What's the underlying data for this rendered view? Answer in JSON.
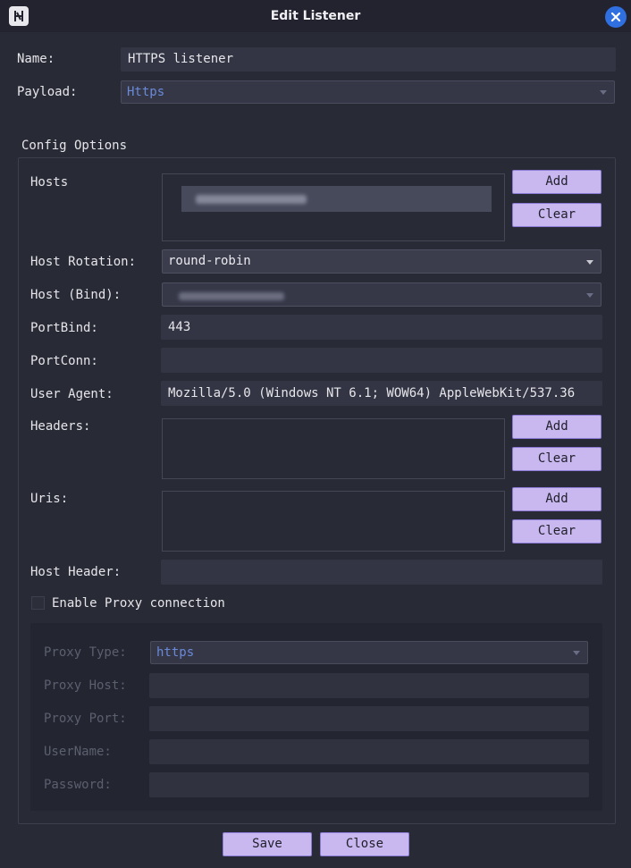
{
  "window": {
    "title": "Edit Listener"
  },
  "name": {
    "label": "Name:",
    "value": "HTTPS listener"
  },
  "payload": {
    "label": "Payload:",
    "value": "Https"
  },
  "config": {
    "group_title": "Config Options",
    "hosts": {
      "label": "Hosts",
      "add_label": "Add",
      "clear_label": "Clear"
    },
    "host_rotation": {
      "label": "Host Rotation:",
      "value": "round-robin"
    },
    "host_bind": {
      "label": "Host (Bind):"
    },
    "port_bind": {
      "label": "PortBind:",
      "value": "443"
    },
    "port_conn": {
      "label": "PortConn:",
      "value": ""
    },
    "user_agent": {
      "label": "User Agent:",
      "value": "Mozilla/5.0 (Windows NT 6.1; WOW64) AppleWebKit/537.36"
    },
    "headers": {
      "label": "Headers:",
      "add_label": "Add",
      "clear_label": "Clear"
    },
    "uris": {
      "label": "Uris:",
      "add_label": "Add",
      "clear_label": "Clear"
    },
    "host_header": {
      "label": "Host Header:",
      "value": ""
    }
  },
  "proxy": {
    "enable_label": "Enable Proxy connection",
    "enabled": false,
    "type": {
      "label": "Proxy Type:",
      "value": "https"
    },
    "host": {
      "label": "Proxy Host:",
      "value": ""
    },
    "port": {
      "label": "Proxy Port:",
      "value": ""
    },
    "username": {
      "label": "UserName:",
      "value": ""
    },
    "password": {
      "label": "Password:",
      "value": ""
    }
  },
  "footer": {
    "save_label": "Save",
    "close_label": "Close"
  },
  "colors": {
    "accent_button": "#c9b7ef",
    "close_icon_bg": "#2f6fe0",
    "background": "#282a36"
  }
}
